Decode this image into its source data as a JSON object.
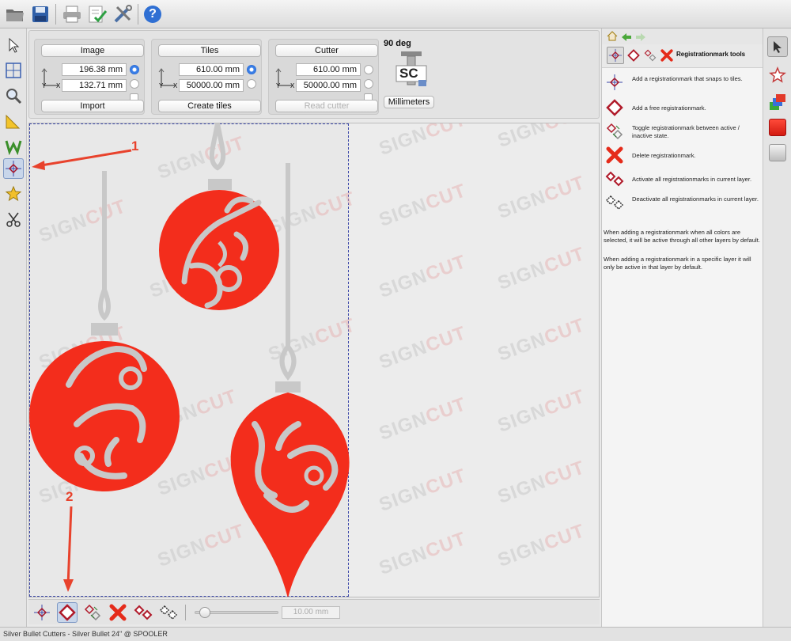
{
  "toolbar": {
    "icons": [
      "open-folder-icon",
      "save-disk-icon",
      "print-icon",
      "checklist-icon",
      "tools-icon",
      "help-icon"
    ],
    "help_glyph": "?"
  },
  "params": {
    "image": {
      "button": "Image",
      "x": "196.38 mm",
      "y": "132.71 mm",
      "action": "Import"
    },
    "tiles": {
      "button": "Tiles",
      "x": "610.00 mm",
      "y": "50000.00 mm",
      "action": "Create tiles"
    },
    "cutter": {
      "button": "Cutter",
      "x": "610.00 mm",
      "y": "50000.00 mm",
      "action": "Read cutter"
    },
    "rotation": "90 deg",
    "logo_text": "SC",
    "units": "Millimeters"
  },
  "axis_labels": {
    "y": "Y",
    "x": "X"
  },
  "watermark": {
    "sign": "SIGN",
    "cut": "CUT"
  },
  "annotations": {
    "one": "1",
    "two": "2"
  },
  "bottom": {
    "zoom_value": "10.00 mm",
    "zoom_fraction": 0.05
  },
  "right_panel": {
    "title": "Registrationmark tools",
    "items": [
      {
        "icon": "snap-registration-mark-icon",
        "text": "Add a registrationmark that snaps to tiles."
      },
      {
        "icon": "free-registration-mark-icon",
        "text": "Add a free registrationmark."
      },
      {
        "icon": "toggle-registration-mark-icon",
        "text": "Toggle registrationmark between active / inactive state."
      },
      {
        "icon": "delete-registration-mark-icon",
        "text": "Delete registrationmark."
      },
      {
        "icon": "activate-all-marks-icon",
        "text": "Activate all registrationmarks in current layer."
      },
      {
        "icon": "deactivate-all-marks-icon",
        "text": "Deactivate all registrationmarks in current layer."
      }
    ],
    "note1": "When adding a registrationmark when all colors are selected, it will be active through all other layers by default.",
    "note2": "When adding a registrationmark in a specific layer it will only be active in that layer by default."
  },
  "status": "Silver Bullet Cutters - Silver Bullet 24\" @ SPOOLER",
  "colors": {
    "ornament": "#f32d1c",
    "filigree": "#c8c8c8",
    "accent": "#e8422c",
    "tile_border": "#3a46a8"
  }
}
